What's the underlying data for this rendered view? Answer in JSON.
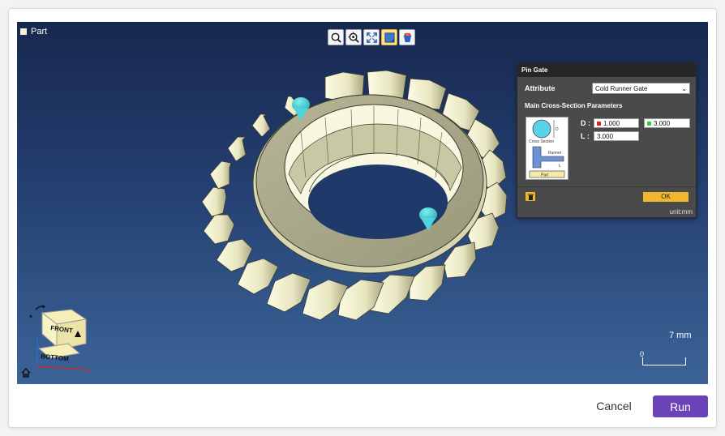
{
  "viewport": {
    "part_label": "Part",
    "part_color": "#f6f5d7",
    "toolbar": [
      {
        "icon": "zoom-icon",
        "active": false
      },
      {
        "icon": "zoom-region-icon",
        "active": false
      },
      {
        "icon": "fit-view-icon",
        "active": false
      },
      {
        "icon": "part-view-icon",
        "active": true
      },
      {
        "icon": "gate-view-icon",
        "active": false
      }
    ],
    "scale": {
      "label": "7 mm",
      "zero": "0"
    },
    "navcube": {
      "front": "FRONT",
      "bottom": "BOTTOM"
    }
  },
  "pin_gate": {
    "title": "Pin Gate",
    "attribute_label": "Attribute",
    "attribute_value": "Cold Runner Gate",
    "section_title": "Main Cross-Section Parameters",
    "diagram": {
      "cross_section": "Cross Section",
      "runner": "Runner",
      "part": "Part",
      "d_mark": "D",
      "l_mark": "L"
    },
    "d_label": "D :",
    "d_value_1": "1.000",
    "d_value_2": "3.000",
    "l_label": "L :",
    "l_value": "3.000",
    "ok_label": "OK",
    "unit": "unit:mm",
    "d1_color": "#e0221f",
    "d2_color": "#2ecc40"
  },
  "footer": {
    "cancel_label": "Cancel",
    "run_label": "Run",
    "run_color": "#6943b7"
  }
}
